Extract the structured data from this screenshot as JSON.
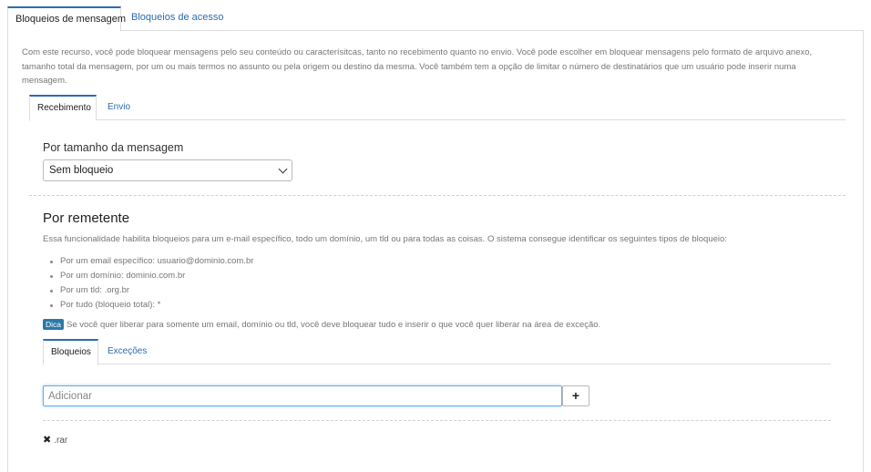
{
  "top_tabs": [
    {
      "label": "Bloqueios de mensagem",
      "active": true
    },
    {
      "label": "Bloqueios de acesso",
      "active": false
    }
  ],
  "intro": "Com este recurso, você pode bloquear mensagens pelo seu conteúdo ou caracterísitcas, tanto no recebimento quanto no envio. Você pode escolher em bloquear mensagens pelo formato de arquivo anexo, tamanho total da mensagem, por um ou mais termos no assunto ou pela origem ou destino da mesma. Você também tem a opção de limitar o número de destinatários que um usuário pode inserir numa mensagem.",
  "direction_tabs": [
    {
      "label": "Recebimento",
      "active": true
    },
    {
      "label": "Envio",
      "active": false
    }
  ],
  "size_filter": {
    "label": "Por tamanho da mensagem",
    "selected": "Sem bloqueio"
  },
  "sender_section": {
    "title": "Por remetente",
    "description": "Essa funcionalidade habilita bloqueios para um e-mail específico, todo um domínio, um tld ou para todas as coisas. O sistema consegue identificar os seguintes tipos de bloqueio:",
    "types": [
      "Por um email específico: usuario@dominio.com.br",
      "Por um domínio: dominio.com.br",
      "Por um tld: .org.br",
      "Por tudo (bloqueio total): *"
    ],
    "tip_badge": "Dica",
    "tip_text": "Se você quer liberar para somente um email, domínio ou tld, você deve bloquear tudo e inserir o que você quer liberar na área de exceção."
  },
  "list_tabs": [
    {
      "label": "Bloqueios",
      "active": true
    },
    {
      "label": "Exceções",
      "active": false
    }
  ],
  "add_field": {
    "placeholder": "Adicionar",
    "button_icon": "plus-icon",
    "button_label": "+"
  },
  "entries": [
    {
      "value": ".rar",
      "remove_icon": "close-icon",
      "remove_glyph": "✖"
    }
  ],
  "colors": {
    "accent": "#2b6cb0",
    "badge": "#2d78a8",
    "focus_border": "#66afe9"
  }
}
